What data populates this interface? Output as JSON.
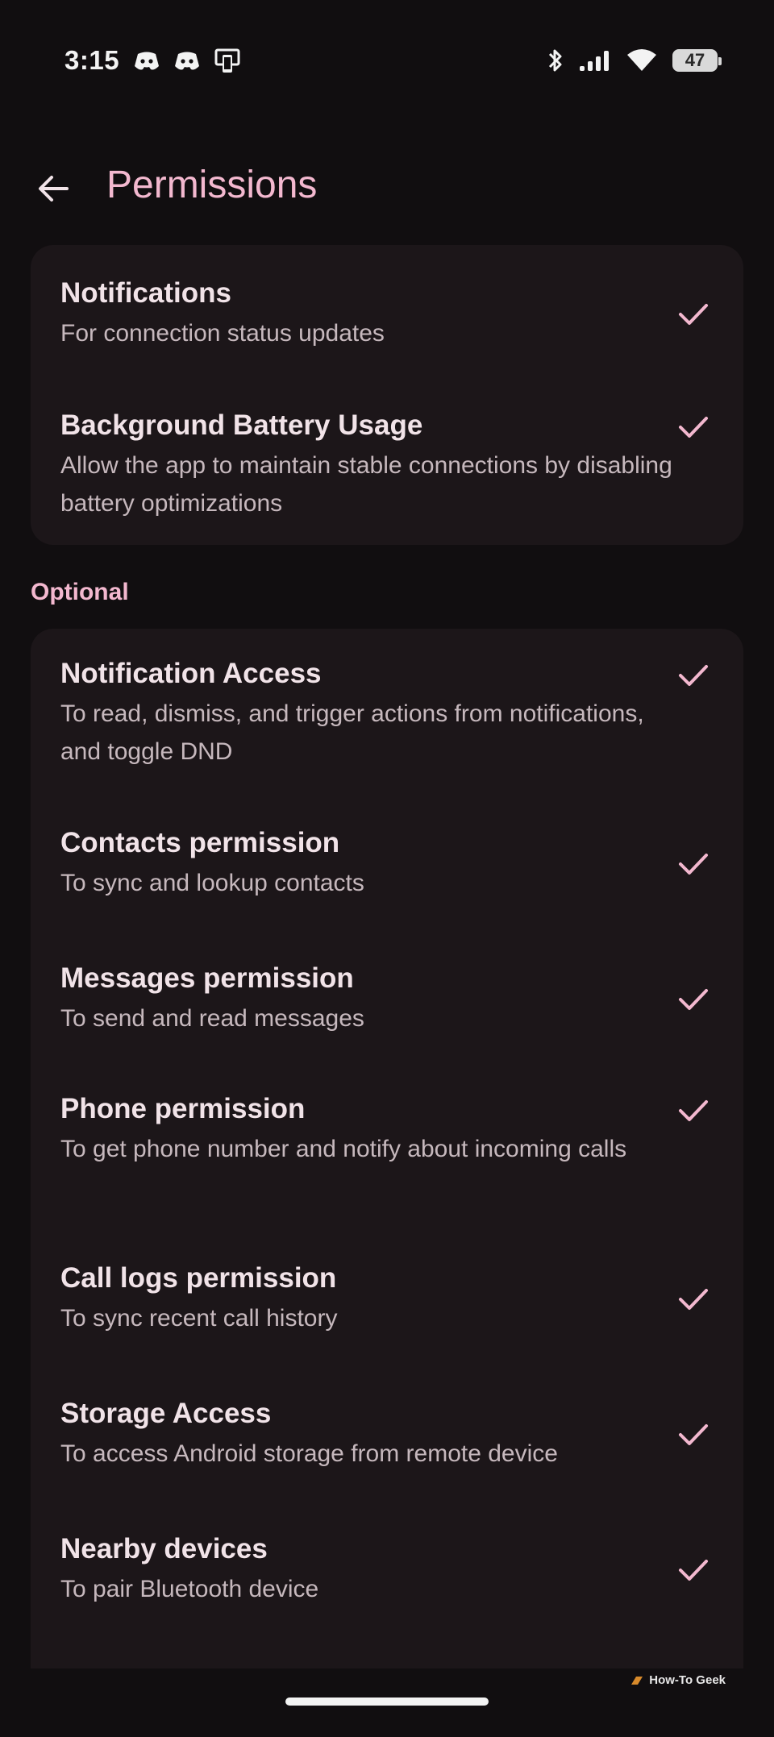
{
  "status_bar": {
    "time": "3:15",
    "left_icons": [
      "discord-icon",
      "discord-icon",
      "phone-link-icon"
    ],
    "right_icons": [
      "bluetooth-icon",
      "signal-icon",
      "wifi-icon"
    ],
    "battery": "47"
  },
  "app_bar": {
    "title": "Permissions"
  },
  "required": {
    "items": [
      {
        "title": "Notifications",
        "desc": "For connection status updates"
      },
      {
        "title": "Background Battery Usage",
        "desc": "Allow the app to maintain stable connections by disabling battery optimizations"
      }
    ]
  },
  "optional": {
    "label": "Optional",
    "items": [
      {
        "title": "Notification Access",
        "desc": "To read, dismiss, and trigger actions from notifications, and toggle DND"
      },
      {
        "title": "Contacts permission",
        "desc": "To sync and lookup contacts"
      },
      {
        "title": "Messages permission",
        "desc": "To send and read messages"
      },
      {
        "title": "Phone permission",
        "desc": "To get phone number and notify about incoming calls"
      },
      {
        "title": "Call logs permission",
        "desc": "To sync recent call history"
      },
      {
        "title": "Storage Access",
        "desc": "To access Android storage from remote device"
      },
      {
        "title": "Nearby devices",
        "desc": "To pair Bluetooth device"
      }
    ]
  },
  "watermark": "How-To Geek",
  "colors": {
    "background": "#110e10",
    "card": "#1c1619",
    "accent": "#f3b8cf",
    "title_text": "#f1e3e8",
    "desc_text": "#c6b8bd"
  }
}
